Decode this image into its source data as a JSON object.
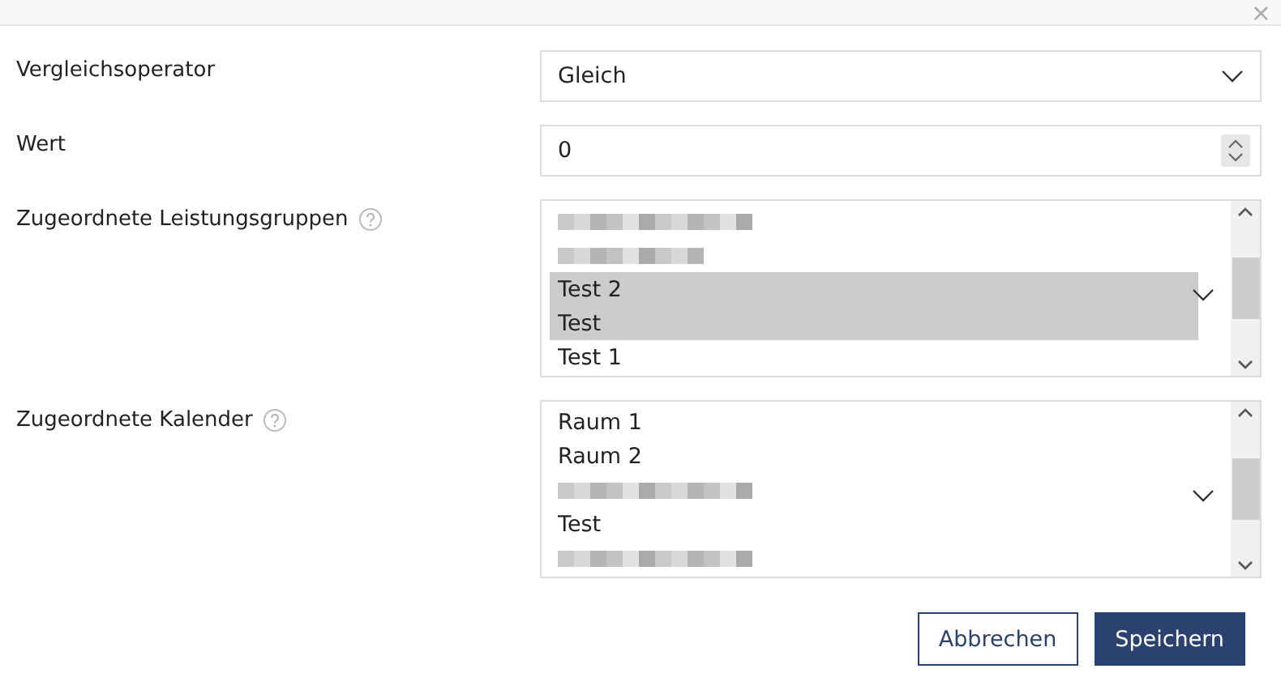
{
  "dialog": {
    "close_label": "×"
  },
  "fields": [
    {
      "kind": "select",
      "label": "Vergleichsoperator",
      "value": "Gleich"
    },
    {
      "kind": "number",
      "label": "Wert",
      "value": "0"
    },
    {
      "kind": "multiselect",
      "label": "Zugeordnete Leistungsgruppen",
      "help": true,
      "items": [
        {
          "kind": "blurred",
          "selected": false
        },
        {
          "kind": "blurred",
          "selected": false
        },
        {
          "kind": "text",
          "text": "Test 2",
          "selected": true
        },
        {
          "kind": "text",
          "text": "Test",
          "selected": true
        },
        {
          "kind": "text",
          "text": "Test 1",
          "selected": false
        }
      ]
    },
    {
      "kind": "multiselect",
      "label": "Zugeordnete Kalender",
      "help": true,
      "items": [
        {
          "kind": "text",
          "text": "Raum 1",
          "selected": false
        },
        {
          "kind": "text",
          "text": "Raum 2",
          "selected": false
        },
        {
          "kind": "blurred",
          "selected": false
        },
        {
          "kind": "text",
          "text": "Test",
          "selected": false
        },
        {
          "kind": "blurred",
          "selected": false
        }
      ]
    }
  ],
  "buttons": [
    {
      "label": "Abbrechen",
      "kind": "secondary"
    },
    {
      "label": "Speichern",
      "kind": "primary"
    }
  ]
}
